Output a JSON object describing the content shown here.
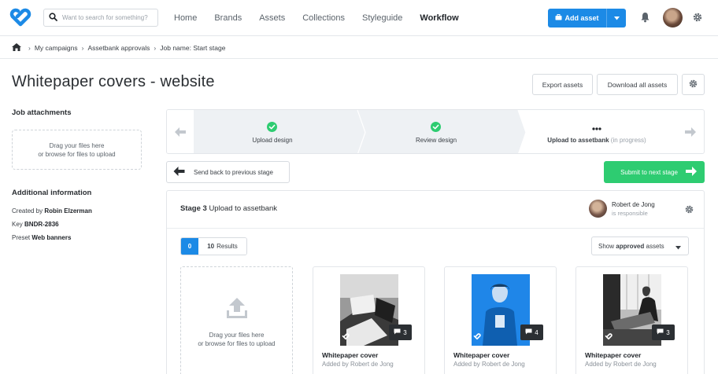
{
  "search": {
    "placeholder": "Want to search for something?"
  },
  "nav": {
    "links": [
      "Home",
      "Brands",
      "Assets",
      "Collections",
      "Styleguide",
      "Workflow"
    ],
    "active": "Workflow"
  },
  "add_asset_label": "Add asset",
  "breadcrumb": [
    "My campaigns",
    "Assetbank approvals",
    "Job name: Start stage"
  ],
  "page_title": "Whitepaper covers - website",
  "actions": {
    "export": "Export assets",
    "download": "Download all assets"
  },
  "sidebar": {
    "attachments_heading": "Job attachments",
    "drop_line1": "Drag your files here",
    "drop_line2": "or browse for files to upload",
    "info_heading": "Additional information",
    "created_by_label": "Created by",
    "created_by_value": "Robin Elzerman",
    "key_label": "Key",
    "key_value": "BNDR-2836",
    "preset_label": "Preset",
    "preset_value": "Web banners"
  },
  "stepper": {
    "steps": [
      {
        "label": "Upload design",
        "status": "done"
      },
      {
        "label": "Review design",
        "status": "done"
      },
      {
        "label": "Upload to assetbank",
        "status": "in progress",
        "status_text": "(in progress)"
      }
    ]
  },
  "buttons": {
    "send_back": "Send back to previous stage",
    "submit": "Submit to next stage"
  },
  "stage": {
    "number_label": "Stage 3",
    "name": "Upload to assetbank",
    "assignee_name": "Robert de Jong",
    "assignee_role": "is responsible",
    "count": "0",
    "results_count": "10",
    "results_label": "Results",
    "show_prefix": "Show",
    "show_value": "approved",
    "show_suffix": "assets",
    "drop_line1": "Drag your files here",
    "drop_line2": "or browse for files to upload"
  },
  "assets": [
    {
      "title": "Whitepaper cover",
      "added_by": "Added by Robert de Jong",
      "comments": "3"
    },
    {
      "title": "Whitepaper cover",
      "added_by": "Added by Robert de Jong",
      "comments": "4"
    },
    {
      "title": "Whitepaper cover",
      "added_by": "Added by Robert de Jong",
      "comments": "3"
    }
  ],
  "colors": {
    "primary": "#1c8ae6",
    "success": "#2ecc71",
    "brand": "#1c8ae6"
  }
}
